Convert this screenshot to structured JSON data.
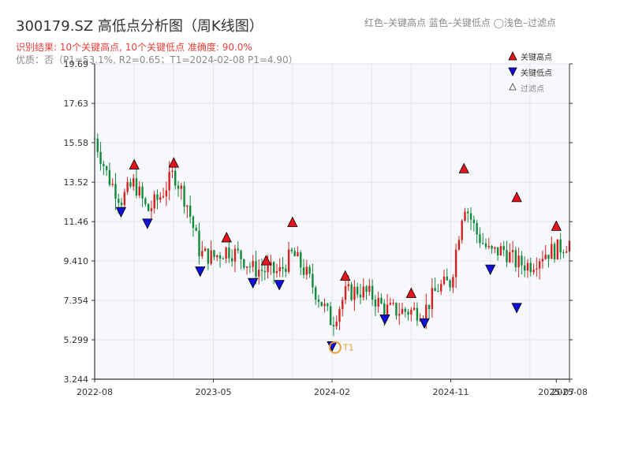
{
  "header": {
    "title": "300179.SZ 高低点分析图（周K线图）",
    "result_line": "识别结果: 10个关键高点, 10个关键低点  准确度: 90.0%",
    "quality_line": "优质：否（P1=53.1%, R2=0.65；T1=2024-02-08 P1=4.90）",
    "legend_text": "红色–关键高点      蓝色–关键低点   ◯浅色–过滤点"
  },
  "legend": {
    "high": "关键高点",
    "low": "关键低点",
    "filtered": "过滤点"
  },
  "colors": {
    "up": "#d62020",
    "down": "#118a3c",
    "high_marker": "#e8141c",
    "low_marker": "#1010d8",
    "t1_ring": "#e8a33a",
    "plot_bg": "#f7f8fb",
    "grid": "#e2e5ea"
  },
  "chart_data": {
    "type": "candlestick",
    "y_ticks": [
      "3.244",
      "5.299",
      "7.354",
      "9.410",
      "11.46",
      "13.52",
      "15.58",
      "17.63",
      "19.69"
    ],
    "ylim": [
      3.244,
      19.69
    ],
    "x_ticks": [
      "2022-08",
      "2023-05",
      "2024-02",
      "2024-11",
      "2025-07",
      "2025-08"
    ],
    "xlim": [
      "2022-08",
      "2025-08"
    ],
    "grid": true,
    "legend_position": "top-right",
    "t1_label": "T1",
    "t1": {
      "x": "2024-02-08",
      "y": 4.9
    },
    "key_highs": [
      {
        "x": "2022-11",
        "y": 14.2
      },
      {
        "x": "2023-02",
        "y": 14.3
      },
      {
        "x": "2023-06",
        "y": 10.4
      },
      {
        "x": "2023-09",
        "y": 9.2
      },
      {
        "x": "2023-11",
        "y": 11.2
      },
      {
        "x": "2024-03",
        "y": 8.4
      },
      {
        "x": "2024-08",
        "y": 7.5
      },
      {
        "x": "2024-12",
        "y": 14.0
      },
      {
        "x": "2025-04",
        "y": 12.5
      },
      {
        "x": "2025-07",
        "y": 11.0
      }
    ],
    "key_lows": [
      {
        "x": "2022-10",
        "y": 12.2
      },
      {
        "x": "2022-12",
        "y": 11.6
      },
      {
        "x": "2023-04",
        "y": 9.1
      },
      {
        "x": "2023-08",
        "y": 8.5
      },
      {
        "x": "2023-10",
        "y": 8.4
      },
      {
        "x": "2024-02",
        "y": 5.2
      },
      {
        "x": "2024-06",
        "y": 6.6
      },
      {
        "x": "2024-09",
        "y": 6.4
      },
      {
        "x": "2025-02",
        "y": 9.2
      },
      {
        "x": "2025-04",
        "y": 7.2
      }
    ],
    "anchors": [
      [
        "2022-08",
        15.8
      ],
      [
        "2022-09",
        13.8
      ],
      [
        "2022-10",
        12.6
      ],
      [
        "2022-11",
        13.5
      ],
      [
        "2022-12",
        12.0
      ],
      [
        "2023-01",
        12.8
      ],
      [
        "2023-02",
        14.0
      ],
      [
        "2023-03",
        12.4
      ],
      [
        "2023-04",
        9.8
      ],
      [
        "2023-05",
        9.6
      ],
      [
        "2023-06",
        10.0
      ],
      [
        "2023-07",
        9.7
      ],
      [
        "2023-08",
        9.0
      ],
      [
        "2023-09",
        8.9
      ],
      [
        "2023-10",
        8.8
      ],
      [
        "2023-11",
        9.8
      ],
      [
        "2023-12",
        8.8
      ],
      [
        "2024-01",
        7.5
      ],
      [
        "2024-02",
        6.2
      ],
      [
        "2024-03",
        7.7
      ],
      [
        "2024-04",
        7.9
      ],
      [
        "2024-05",
        7.6
      ],
      [
        "2024-06",
        6.9
      ],
      [
        "2024-07",
        6.8
      ],
      [
        "2024-08",
        6.8
      ],
      [
        "2024-09",
        6.8
      ],
      [
        "2024-10",
        8.0
      ],
      [
        "2024-11",
        8.3
      ],
      [
        "2024-12",
        12.5
      ],
      [
        "2025-01",
        10.8
      ],
      [
        "2025-02",
        9.8
      ],
      [
        "2025-03",
        10.0
      ],
      [
        "2025-04",
        9.3
      ],
      [
        "2025-05",
        9.2
      ],
      [
        "2025-06",
        9.8
      ],
      [
        "2025-07",
        10.0
      ],
      [
        "2025-08",
        10.4
      ]
    ]
  }
}
